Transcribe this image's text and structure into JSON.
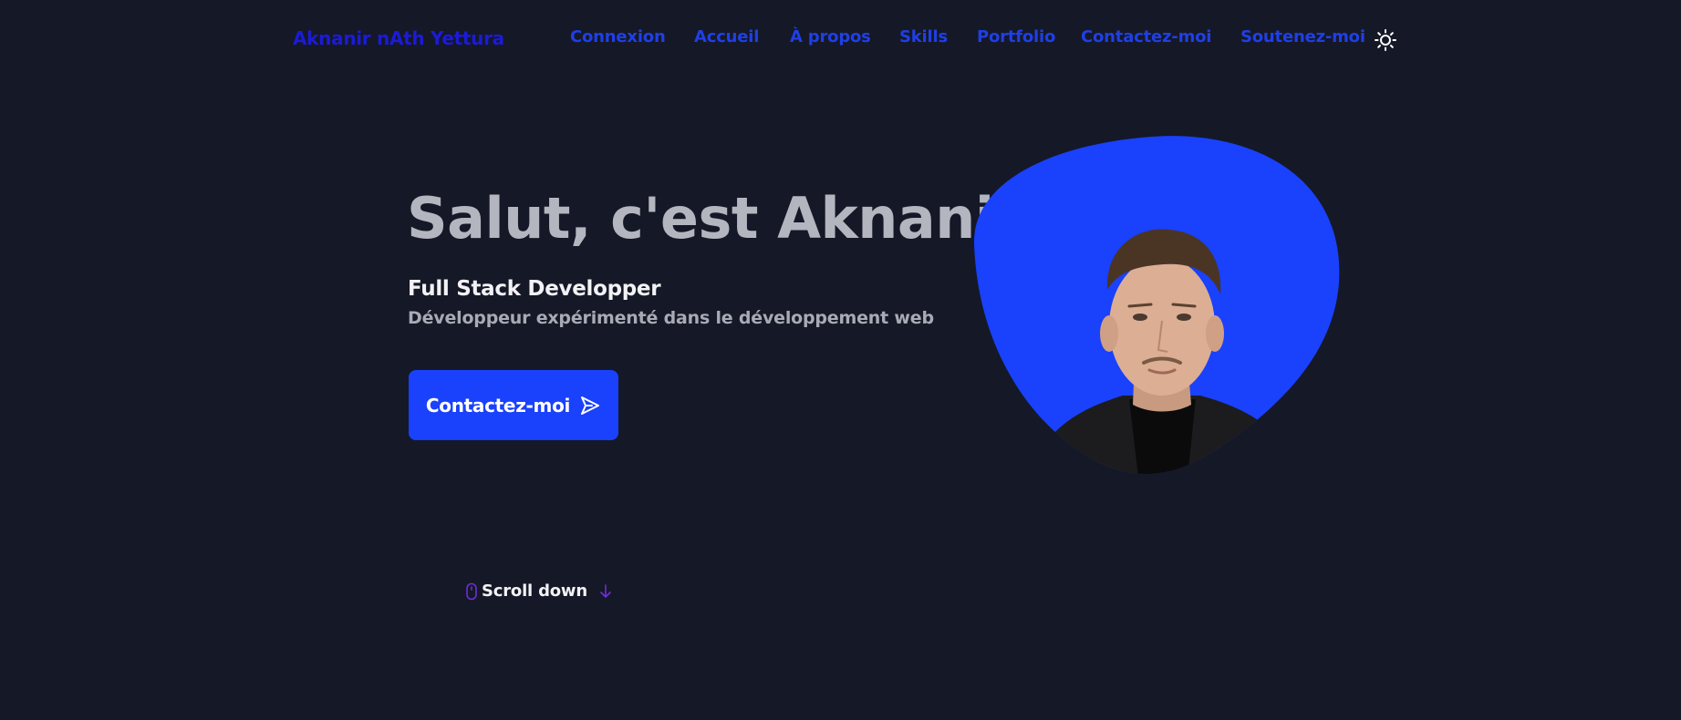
{
  "header": {
    "brand": "Aknanir nAth Yettura",
    "nav": [
      {
        "label": "Connexion"
      },
      {
        "label": "Accueil"
      },
      {
        "label": "À propos"
      },
      {
        "label": "Skills"
      },
      {
        "label": "Portfolio"
      },
      {
        "label": "Contactez-moi"
      },
      {
        "label": "Soutenez-moi"
      }
    ],
    "theme_toggle_icon": "sun-icon"
  },
  "hero": {
    "title": "Salut, c'est Aknanir",
    "subtitle": "Full Stack Developper",
    "description": "Développeur expérimenté dans le développement web",
    "cta_label": "Contactez-moi",
    "cta_icon": "send-icon",
    "image_icon": "profile-photo"
  },
  "scroll": {
    "label": "Scroll down",
    "mouse_icon": "mouse-icon",
    "arrow_icon": "arrow-down-icon"
  },
  "colors": {
    "background": "#151826",
    "brand": "#1b1bd6",
    "nav_link": "#1f3fe6",
    "accent": "#1a41fb",
    "title": "#b3b5bf",
    "scroll_icon": "#6d2fd6"
  }
}
